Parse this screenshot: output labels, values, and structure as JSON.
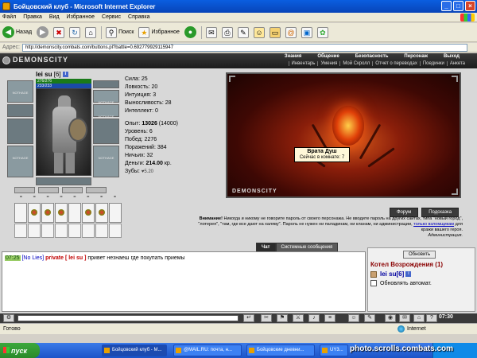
{
  "window": {
    "title": "Бойцовский клуб - Microsoft Internet Explorer",
    "btn_min": "_",
    "btn_max": "□",
    "btn_close": "×"
  },
  "menu": [
    "Файл",
    "Правка",
    "Вид",
    "Избранное",
    "Сервис",
    "Справка"
  ],
  "toolbar": {
    "back": "Назад",
    "search": "Поиск",
    "favorites": "Избранное"
  },
  "address": {
    "label": "Адрес:",
    "url": "http://demonscity.combats.com/buttons.pl?battle=0.692779929115947"
  },
  "site": {
    "logo": "DEMONSCITY",
    "nav_top": [
      "Знания",
      "Общение",
      "Безопасность",
      "Персонаж",
      "Выход"
    ],
    "nav_sub": [
      "Инвентарь",
      "Умения",
      "Мой Скролл",
      "Отчет о переводах",
      "Поединки",
      "Анкета"
    ]
  },
  "character": {
    "name": "lei su",
    "level": "[6]",
    "info": "i",
    "hp": "276/276",
    "mp": "233/233",
    "slot_text": "NOTHAGE"
  },
  "stats": {
    "strength": "Сила: 25",
    "agility": "Ловкость: 20",
    "intuition": "Интуиция: 3",
    "endurance": "Выносливость: 28",
    "intellect": "Интеллект: 0",
    "exp_label": "Опыт: ",
    "exp_value": "13026",
    "exp_next": " (14000)",
    "level": "Уровень: 6",
    "wins": "Побед: 2276",
    "losses": "Поражений: 384",
    "draws": "Ничьих: 32",
    "money_label": "Деньги: ",
    "money_value": "214.00",
    "money_unit": " кр.",
    "teeth_label": "Зубы: ",
    "teeth_value": "♥5.20"
  },
  "scene": {
    "tooltip_title": "Врата Душ",
    "tooltip_text": "Сейчас в комнате: 7",
    "logo": "DEMONSCITY",
    "forum_btn": "Форум",
    "hint_btn": "Подсказка"
  },
  "warning": {
    "label": "Внимание!",
    "text": " Никогда и никому не говорите пароль от своего персонажа. Не вводите пароль на других сайтах, типа \"новый город\", \"лотерея\", \"там, где все дают на халяву\". Пароль не нужен ни паладинам, ни кланам, ни администрации,",
    "link": "только взломщикам",
    "text_end": " для кражи вашего героя.",
    "signature": "Администрация."
  },
  "chat": {
    "tab_chat": "Чат",
    "tab_system": "Системные сообщения",
    "time": "07:25",
    "nick": "[No Lies]",
    "private": "private [ lei su ]",
    "message": "привет незнаеш где покупать приемы"
  },
  "room": {
    "refresh": "Обновить",
    "title": "Котел Возрождения (1)",
    "user": "lei su[6]",
    "auto_refresh": "Обновлять автомат."
  },
  "chat_toolbar": {
    "clock": "07:30"
  },
  "status": {
    "ready": "Готово",
    "zone": "Internet"
  },
  "taskbar": {
    "start": "пуск",
    "tasks": [
      "Бойцовский клуб - M...",
      "@MAIL.RU: почта, н...",
      "Бойцовские дневни...",
      "UY3..."
    ],
    "watermark": "photo.scrolls.combats.com"
  }
}
